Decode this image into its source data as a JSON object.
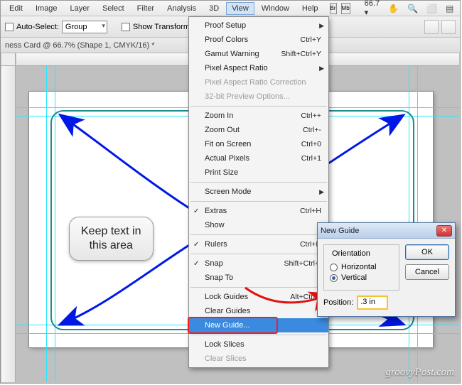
{
  "menubar": {
    "items": [
      "Edit",
      "Image",
      "Layer",
      "Select",
      "Filter",
      "Analysis",
      "3D",
      "View",
      "Window",
      "Help"
    ],
    "active_index": 7,
    "icon_badges": [
      "Br",
      "Mb"
    ],
    "zoom_label": "66.7",
    "tool_glyphs": [
      "✋",
      "🔍",
      "⬜",
      "▤",
      "▦"
    ]
  },
  "optionbar": {
    "autoselect_label": "Auto-Select:",
    "autoselect_value": "Group",
    "showtransform_label": "Show Transform Controls"
  },
  "doc_tab": "ness Card @ 66.7% (Shape 1, CMYK/16) *",
  "dropdown": {
    "groups": [
      [
        {
          "label": "Proof Setup",
          "submenu": true
        },
        {
          "label": "Proof Colors",
          "shortcut": "Ctrl+Y"
        },
        {
          "label": "Gamut Warning",
          "shortcut": "Shift+Ctrl+Y"
        },
        {
          "label": "Pixel Aspect Ratio",
          "submenu": true
        },
        {
          "label": "Pixel Aspect Ratio Correction",
          "disabled": true
        },
        {
          "label": "32-bit Preview Options...",
          "disabled": true
        }
      ],
      [
        {
          "label": "Zoom In",
          "shortcut": "Ctrl++"
        },
        {
          "label": "Zoom Out",
          "shortcut": "Ctrl+-"
        },
        {
          "label": "Fit on Screen",
          "shortcut": "Ctrl+0"
        },
        {
          "label": "Actual Pixels",
          "shortcut": "Ctrl+1"
        },
        {
          "label": "Print Size"
        }
      ],
      [
        {
          "label": "Screen Mode",
          "submenu": true
        }
      ],
      [
        {
          "label": "Extras",
          "shortcut": "Ctrl+H",
          "checked": true
        },
        {
          "label": "Show",
          "submenu": true
        }
      ],
      [
        {
          "label": "Rulers",
          "shortcut": "Ctrl+R",
          "checked": true
        }
      ],
      [
        {
          "label": "Snap",
          "shortcut": "Shift+Ctrl+;",
          "checked": true
        },
        {
          "label": "Snap To",
          "submenu": true
        }
      ],
      [
        {
          "label": "Lock Guides",
          "shortcut": "Alt+Ctrl+;"
        },
        {
          "label": "Clear Guides"
        },
        {
          "label": "New Guide...",
          "selected": true
        }
      ],
      [
        {
          "label": "Lock Slices"
        },
        {
          "label": "Clear Slices",
          "disabled": true
        }
      ]
    ]
  },
  "callout": {
    "line1": "Keep text in",
    "line2": "this area"
  },
  "dialog": {
    "title": "New Guide",
    "fieldset": "Orientation",
    "opt_h": "Horizontal",
    "opt_v": "Vertical",
    "selected": "v",
    "ok": "OK",
    "cancel": "Cancel",
    "pos_label": "Position:",
    "pos_value": ".3 in"
  },
  "watermark": "groovyPost.com"
}
